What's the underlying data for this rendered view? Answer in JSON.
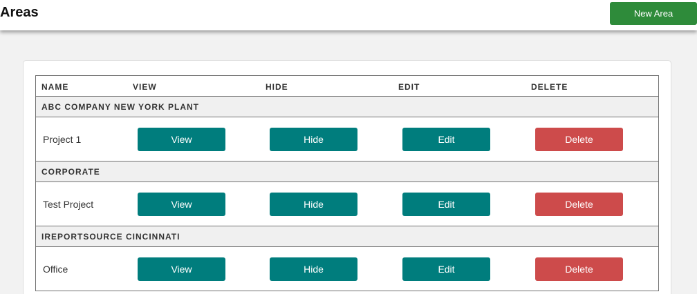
{
  "header": {
    "title": "Areas",
    "new_area_label": "New Area"
  },
  "table": {
    "columns": [
      "NAME",
      "VIEW",
      "HIDE",
      "EDIT",
      "DELETE"
    ],
    "groups": [
      {
        "label": "ABC COMPANY NEW YORK PLANT",
        "rows": [
          {
            "name": "Project 1",
            "view": "View",
            "hide": "Hide",
            "edit": "Edit",
            "delete": "Delete"
          }
        ]
      },
      {
        "label": "CORPORATE",
        "rows": [
          {
            "name": "Test Project",
            "view": "View",
            "hide": "Hide",
            "edit": "Edit",
            "delete": "Delete"
          }
        ]
      },
      {
        "label": "IREPORTSOURCE CINCINNATI",
        "rows": [
          {
            "name": "Office",
            "view": "View",
            "hide": "Hide",
            "edit": "Edit",
            "delete": "Delete"
          }
        ]
      }
    ]
  },
  "colors": {
    "primary_green": "#2e8b3a",
    "teal": "#007d7d",
    "danger_red": "#cd4b4b"
  }
}
